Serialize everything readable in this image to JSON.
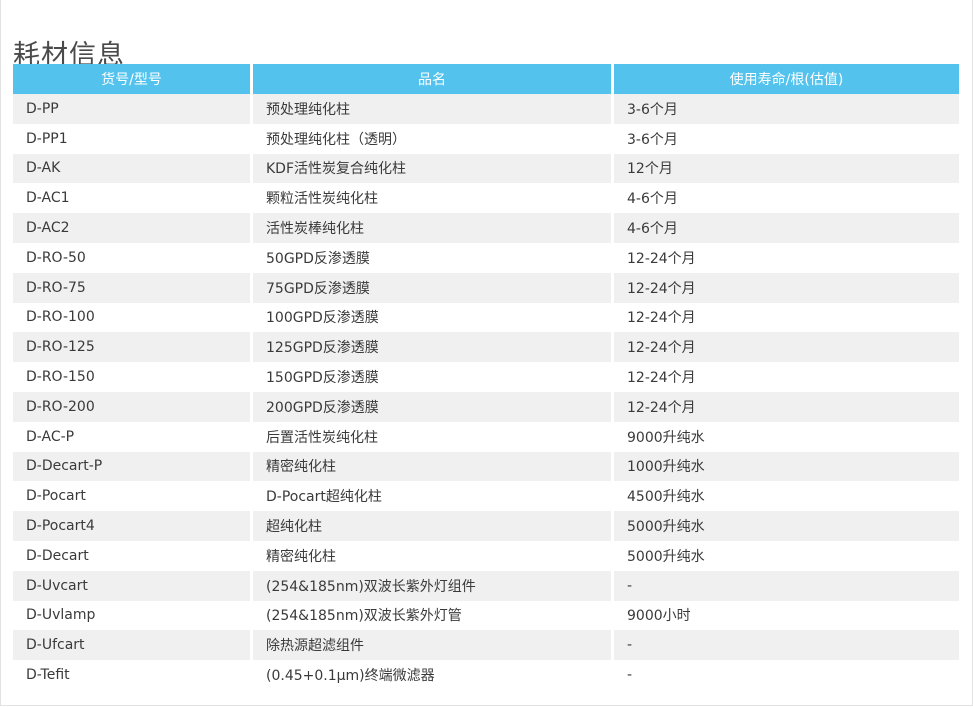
{
  "title": "耗材信息",
  "table": {
    "headers": [
      "货号/型号",
      "品名",
      "使用寿命/根(估值)"
    ],
    "rows": [
      [
        "D-PP",
        "预处理纯化柱",
        "3-6个月"
      ],
      [
        "D-PP1",
        "预处理纯化柱（透明）",
        "3-6个月"
      ],
      [
        "D-AK",
        "KDF活性炭复合纯化柱",
        "12个月"
      ],
      [
        "D-AC1",
        "颗粒活性炭纯化柱",
        "4-6个月"
      ],
      [
        "D-AC2",
        "活性炭棒纯化柱",
        "4-6个月"
      ],
      [
        "D-RO-50",
        "50GPD反渗透膜",
        "12-24个月"
      ],
      [
        "D-RO-75",
        "75GPD反渗透膜",
        "12-24个月"
      ],
      [
        "D-RO-100",
        "100GPD反渗透膜",
        "12-24个月"
      ],
      [
        "D-RO-125",
        "125GPD反渗透膜",
        "12-24个月"
      ],
      [
        "D-RO-150",
        "150GPD反渗透膜",
        "12-24个月"
      ],
      [
        "D-RO-200",
        "200GPD反渗透膜",
        "12-24个月"
      ],
      [
        "D-AC-P",
        "后置活性炭纯化柱",
        "9000升纯水"
      ],
      [
        "D-Decart-P",
        "精密纯化柱",
        "1000升纯水"
      ],
      [
        "D-Pocart",
        "D-Pocart超纯化柱",
        "4500升纯水"
      ],
      [
        "D-Pocart4",
        "超纯化柱",
        "5000升纯水"
      ],
      [
        "D-Decart",
        "精密纯化柱",
        "5000升纯水"
      ],
      [
        "D-Uvcart",
        "(254&185nm)双波长紫外灯组件",
        "-"
      ],
      [
        "D-Uvlamp",
        "(254&185nm)双波长紫外灯管",
        "9000小时"
      ],
      [
        "D-Ufcart",
        "除热源超滤组件",
        "-"
      ],
      [
        "D-Tefit",
        "(0.45+0.1μm)终端微滤器",
        "-"
      ]
    ]
  },
  "colors": {
    "header_bg": "#53c3ee",
    "header_text": "#ffffff",
    "stripe_bg": "#f0f0f0",
    "text": "#3a3a3a"
  }
}
